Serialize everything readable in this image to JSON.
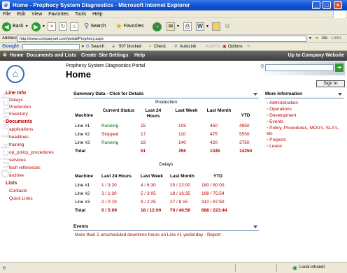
{
  "window": {
    "title": "Home - Prophecy System Diagnostics - Microsoft Internet Explorer",
    "icon_name": "ie-icon",
    "controls": [
      "minimize-icon",
      "maximize-icon",
      "close-icon"
    ]
  },
  "menubar": {
    "items": [
      "File",
      "Edit",
      "View",
      "Favorites",
      "Tools",
      "Help"
    ]
  },
  "toolbar": {
    "back_label": "Back",
    "search_label": "Search",
    "favorites_label": "Favorites"
  },
  "address": {
    "label": "Address",
    "value": "http://www.companyurl.com/portal/Prophecy.aspx",
    "go_label": "Go",
    "links_label": "Links"
  },
  "googlebar": {
    "logo": "Google",
    "search_label": "Search",
    "blocked_label": "507 blocked",
    "check_label": "Check",
    "autolink_label": "AutoLink",
    "autofill_label": "AutoFill",
    "options_label": "Options"
  },
  "nav": {
    "items": [
      "Home",
      "Documents and Lists",
      "Create",
      "Site Settings",
      "Help"
    ],
    "right_link": "Up to Company Website"
  },
  "header": {
    "subtitle": "Prophecy System Diagnostics Portal",
    "title": "Home",
    "signin_label": "Sign In"
  },
  "sidebar": {
    "watermark": "Quick Launch",
    "line_info_heading": "Line Info",
    "line_info_items": [
      "Delays",
      "Production",
      "Inventory"
    ],
    "documents_heading": "Documents",
    "documents_items": [
      "applications",
      "headlines",
      "training",
      "op_policy_procedures",
      "services",
      "tech references",
      "archive"
    ],
    "lists_heading": "Lists",
    "lists_items": [
      "Contacts",
      "Quick Links"
    ]
  },
  "summary": {
    "heading": "Summary Data - Click for Details",
    "production_title": "Production",
    "production_headers": [
      "Machine",
      "Current Status",
      "Last 24 Hours",
      "Last Week",
      "Last Month",
      "YTD"
    ],
    "production_rows": [
      {
        "machine": "Line #1",
        "status": "Running",
        "h24": "15",
        "week": "105",
        "month": "450",
        "ytd": "4950"
      },
      {
        "machine": "Line #2",
        "status": "Stopped",
        "h24": "17",
        "week": "110",
        "month": "475",
        "ytd": "5550"
      },
      {
        "machine": "Line #3",
        "status": "Running",
        "h24": "19",
        "week": "140",
        "month": "420",
        "ytd": "3750"
      }
    ],
    "production_total": {
      "label": "Total",
      "h24": "51",
      "week": "355",
      "month": "1345",
      "ytd": "14250"
    },
    "delays_title": "Delays",
    "delays_headers": [
      "Machine",
      "Last 24 Hours",
      "Last Week",
      "Last Month",
      "YTD"
    ],
    "delays_rows": [
      {
        "machine": "Line #1",
        "h24": "1 / 3:20",
        "week": "4 / 6:30",
        "month": "25 / 22:00",
        "ytd": "180 / 60:00"
      },
      {
        "machine": "Line #2",
        "h24": "3 / 1:30",
        "week": "5 / 3:05",
        "month": "18 / 16:35",
        "ytd": "198 / 75:54"
      },
      {
        "machine": "Line #3",
        "h24": "2 / 0:19",
        "week": "9 / 2:25",
        "month": "27 / 8:15",
        "ytd": "310 / 87:50"
      }
    ],
    "delays_total": {
      "label": "Total",
      "h24": "6 / 5:09",
      "week": "18 / 12:00",
      "month": "70 / 46:50",
      "ytd": "688 / 223:44"
    }
  },
  "events": {
    "heading": "Events",
    "text": "More than 2 unscheduled downtime hours on Line #1 yesterday - Report"
  },
  "more_info": {
    "heading": "More Information",
    "items": [
      "Administration",
      "Operations",
      "Development",
      "Events",
      "Policy, Procedures, MOU's, SLA's, etc",
      "Projects",
      "Lease"
    ]
  },
  "status": {
    "zone": "Local intranet"
  },
  "colors": {
    "accent_red": "#b80000",
    "status_green": "#006600",
    "title_blue": "#0d4fd0",
    "nav_dark": "#3c3c3c"
  }
}
